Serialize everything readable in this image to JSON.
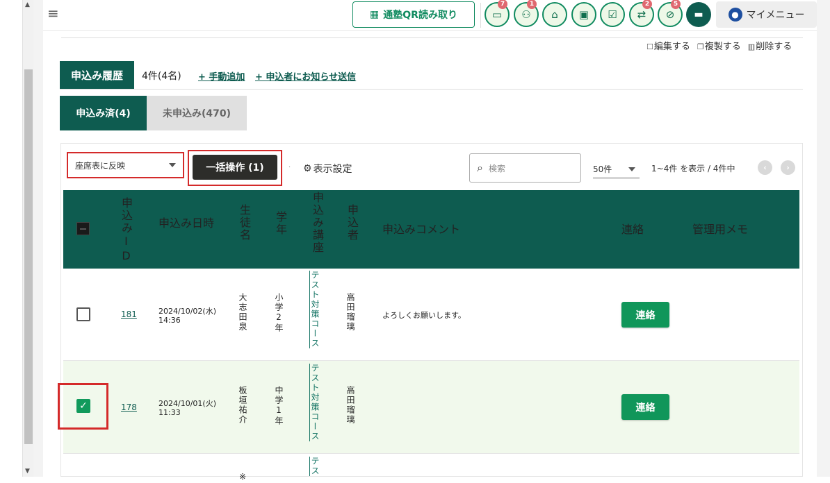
{
  "topbar": {
    "qr_label": "通塾QR読み取り",
    "badges": {
      "message": "7",
      "group": "1",
      "transfer": "2",
      "disabled": "5"
    },
    "mymenu_label": "マイメニュー"
  },
  "edit_actions": {
    "edit": "編集する",
    "copy": "複製する",
    "delete": "削除する"
  },
  "history": {
    "tab_label": "申込み履歴",
    "count": "4件(4名)",
    "add_manual": "+ 手動追加",
    "send_notice": "+ 申込者にお知らせ送信"
  },
  "subtabs": {
    "applied": "申込み済(4)",
    "not_applied": "未申込み(470)"
  },
  "toolbar": {
    "seat_select": "座席表に反映",
    "bulk_label": "一括操作 (1)",
    "display_settings": "表示設定",
    "search_placeholder": "検索",
    "per_page": "50件",
    "range": "1~4件 を表示 / 4件中"
  },
  "table": {
    "headers": {
      "app_id": "申込みID",
      "date": "申込み日時",
      "student": "生徒名",
      "grade": "学年",
      "course": "申込み講座",
      "applicant": "申込者",
      "comment": "申込みコメント",
      "contact": "連絡",
      "memo": "管理用メモ"
    },
    "rows": [
      {
        "checked": false,
        "id": "181",
        "date": "2024/10/02(水)",
        "time": "14:36",
        "student": "大志田泉",
        "grade": "小学2年",
        "course": "テスト対策コース",
        "applicant": "高田瑠璃",
        "comment": "よろしくお願いします。",
        "contact": "連絡"
      },
      {
        "checked": true,
        "id": "178",
        "date": "2024/10/01(火)",
        "time": "11:33",
        "student": "板垣祐介",
        "grade": "中学1年",
        "course": "テスト対策コース",
        "applicant": "高田瑠璃",
        "comment": "",
        "contact": "連絡"
      },
      {
        "student_partial": "※",
        "course_partial": "テス"
      }
    ]
  },
  "colors": {
    "primary": "#0e5c50",
    "accent_green": "#10965a",
    "highlight_red": "#d42a2a",
    "selected_row": "#f1f9ec"
  }
}
